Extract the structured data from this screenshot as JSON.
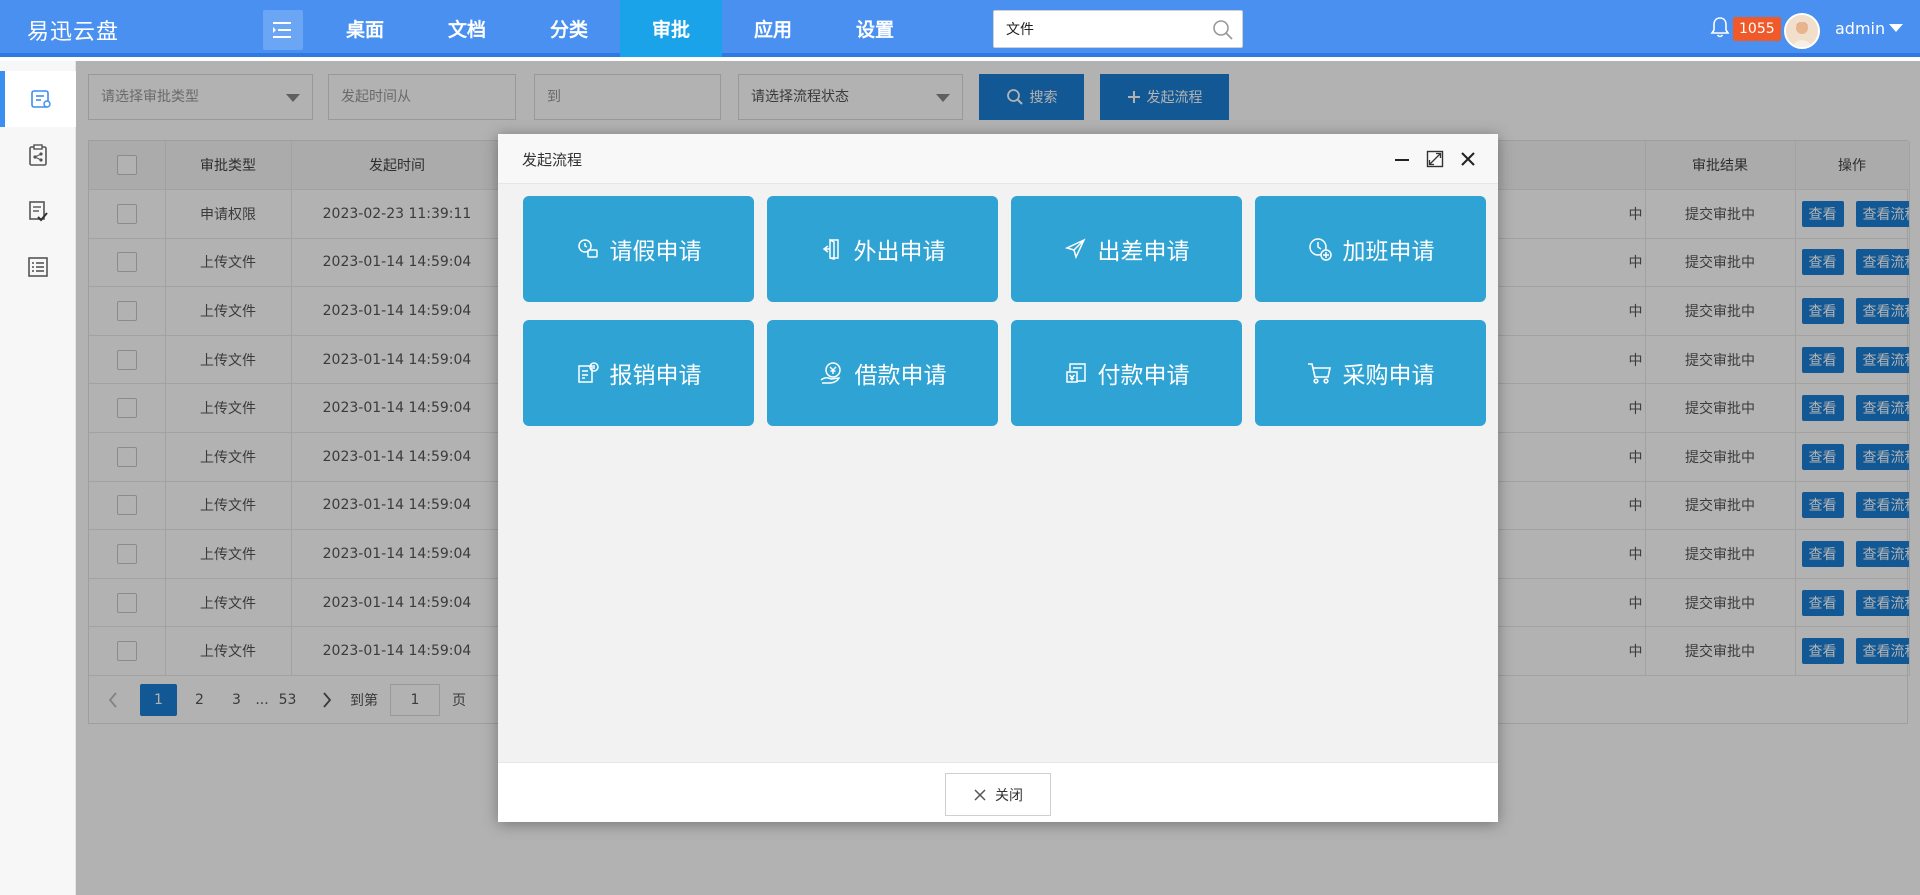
{
  "app": {
    "title": "易迅云盘"
  },
  "nav": {
    "items": [
      "桌面",
      "文档",
      "分类",
      "审批",
      "应用",
      "设置"
    ],
    "active_index": 3
  },
  "search": {
    "value": "文件"
  },
  "user": {
    "notification_count": "1055",
    "name": "admin"
  },
  "sidebar": {
    "icons": [
      "approval-icon",
      "clipboard-share-icon",
      "edit-check-icon",
      "list-icon"
    ],
    "active_index": 0
  },
  "filters": {
    "type_placeholder": "请选择审批类型",
    "time_from_placeholder": "发起时间从",
    "time_to_placeholder": "到",
    "status_placeholder": "请选择流程状态",
    "search_label": "搜索",
    "start_label": "发起流程"
  },
  "table": {
    "columns": [
      "审批类型",
      "发起时间",
      "审批结果",
      "操作"
    ],
    "partial_status": "中",
    "rows": [
      {
        "type": "申请权限",
        "time": "2023-02-23 11:39:11",
        "result": "提交审批中"
      },
      {
        "type": "上传文件",
        "time": "2023-01-14 14:59:04",
        "result": "提交审批中"
      },
      {
        "type": "上传文件",
        "time": "2023-01-14 14:59:04",
        "result": "提交审批中"
      },
      {
        "type": "上传文件",
        "time": "2023-01-14 14:59:04",
        "result": "提交审批中"
      },
      {
        "type": "上传文件",
        "time": "2023-01-14 14:59:04",
        "result": "提交审批中"
      },
      {
        "type": "上传文件",
        "time": "2023-01-14 14:59:04",
        "result": "提交审批中"
      },
      {
        "type": "上传文件",
        "time": "2023-01-14 14:59:04",
        "result": "提交审批中"
      },
      {
        "type": "上传文件",
        "time": "2023-01-14 14:59:04",
        "result": "提交审批中"
      },
      {
        "type": "上传文件",
        "time": "2023-01-14 14:59:04",
        "result": "提交审批中"
      },
      {
        "type": "上传文件",
        "time": "2023-01-14 14:59:04",
        "result": "提交审批中"
      }
    ],
    "view_label": "查看",
    "view_flow_label": "查看流程"
  },
  "pager": {
    "pages": [
      "1",
      "2",
      "3",
      "...",
      "53"
    ],
    "current": "1",
    "goto_label": "到第",
    "goto_value": "1",
    "page_label": "页"
  },
  "modal": {
    "title": "发起流程",
    "tiles": [
      {
        "label": "请假申请",
        "icon": "leave-icon"
      },
      {
        "label": "外出申请",
        "icon": "go-out-icon"
      },
      {
        "label": "出差申请",
        "icon": "plane-icon"
      },
      {
        "label": "加班申请",
        "icon": "overtime-clock-icon"
      },
      {
        "label": "报销申请",
        "icon": "reimburse-icon"
      },
      {
        "label": "借款申请",
        "icon": "loan-icon"
      },
      {
        "label": "付款申请",
        "icon": "payment-icon"
      },
      {
        "label": "采购申请",
        "icon": "cart-icon"
      }
    ],
    "close_label": "关闭"
  }
}
